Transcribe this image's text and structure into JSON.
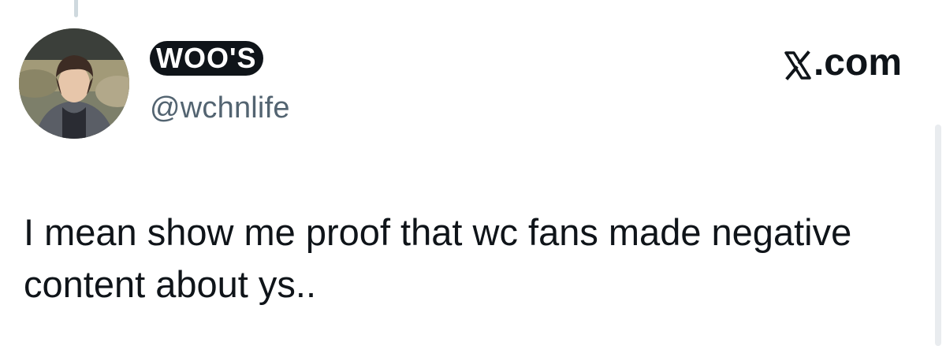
{
  "tweet": {
    "display_name": "WOO'S",
    "handle": "@wchnlife",
    "text": "I mean show me proof that wc fans made negative content about ys.."
  },
  "brand": {
    "label": ".com",
    "icon": "x-logo-icon"
  },
  "colors": {
    "text": "#0f1419",
    "muted": "#536471",
    "background": "#ffffff"
  }
}
